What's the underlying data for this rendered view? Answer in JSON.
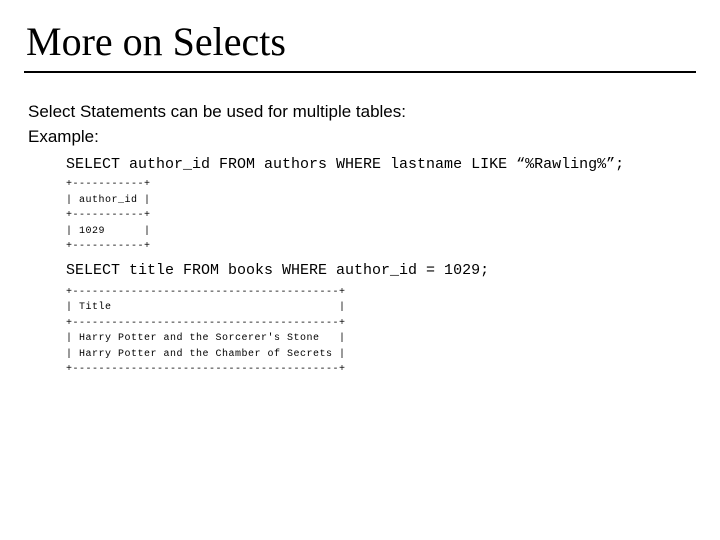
{
  "title": "More on Selects",
  "lead1": "Select Statements can be used for multiple tables:",
  "lead2": "Example:",
  "query1": "SELECT author_id FROM authors WHERE lastname LIKE “%Rawling%”;",
  "result1": "+-----------+\n| author_id |\n+-----------+\n| 1029      |\n+-----------+",
  "query2": "SELECT title FROM books WHERE author_id = 1029;",
  "result2": "+-----------------------------------------+\n| Title                                   |\n+-----------------------------------------+\n| Harry Potter and the Sorcerer's Stone   |\n| Harry Potter and the Chamber of Secrets |\n+-----------------------------------------+",
  "chart_data": {
    "type": "table",
    "tables": [
      {
        "columns": [
          "author_id"
        ],
        "rows": [
          [
            "1029"
          ]
        ]
      },
      {
        "columns": [
          "Title"
        ],
        "rows": [
          [
            "Harry Potter and the Sorcerer's Stone"
          ],
          [
            "Harry Potter and the Chamber of Secrets"
          ]
        ]
      }
    ]
  }
}
